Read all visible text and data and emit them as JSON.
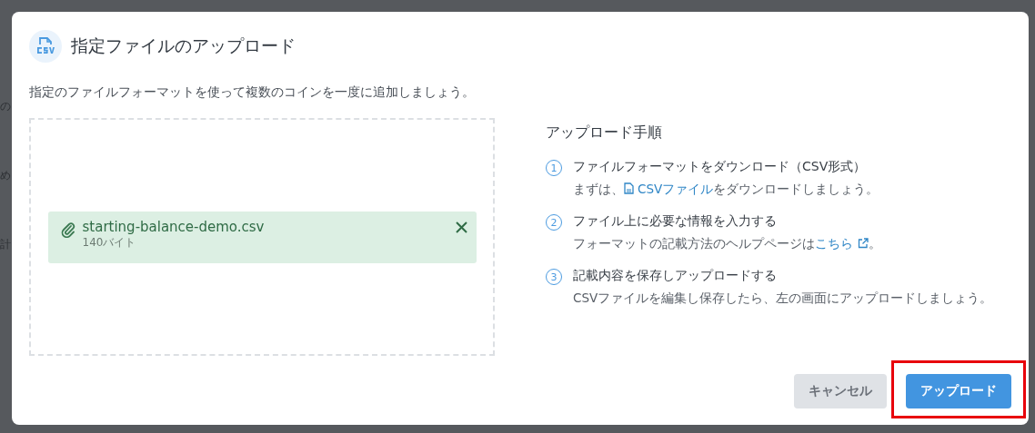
{
  "backdrop": {
    "fragments": [
      "の",
      "め",
      "計"
    ]
  },
  "dialog": {
    "title": "指定ファイルのアップロード",
    "description": "指定のファイルフォーマットを使って複数のコインを一度に追加しましょう。",
    "file": {
      "name": "starting-balance-demo.csv",
      "size": "140バイト"
    },
    "steps_heading": "アップロード手順",
    "steps": [
      {
        "number": "1",
        "title": "ファイルフォーマットをダウンロード（CSV形式）",
        "parts": [
          {
            "kind": "text",
            "text": "まずは、"
          },
          {
            "kind": "file-link",
            "text": "CSVファイル"
          },
          {
            "kind": "text",
            "text": "をダウンロードしましょう。"
          }
        ]
      },
      {
        "number": "2",
        "title": "ファイル上に必要な情報を入力する",
        "parts": [
          {
            "kind": "text",
            "text": "フォーマットの記載方法のヘルプページは"
          },
          {
            "kind": "external-link",
            "text": "こちら"
          },
          {
            "kind": "text",
            "text": "。"
          }
        ]
      },
      {
        "number": "3",
        "title": "記載内容を保存しアップロードする",
        "parts": [
          {
            "kind": "text",
            "text": "CSVファイルを編集し保存したら、左の画面にアップロードしましょう。"
          }
        ]
      }
    ],
    "buttons": [
      {
        "label": "キャンセル",
        "kind": "secondary",
        "highlighted": false
      },
      {
        "label": "アップロード",
        "kind": "primary",
        "highlighted": true
      }
    ]
  }
}
